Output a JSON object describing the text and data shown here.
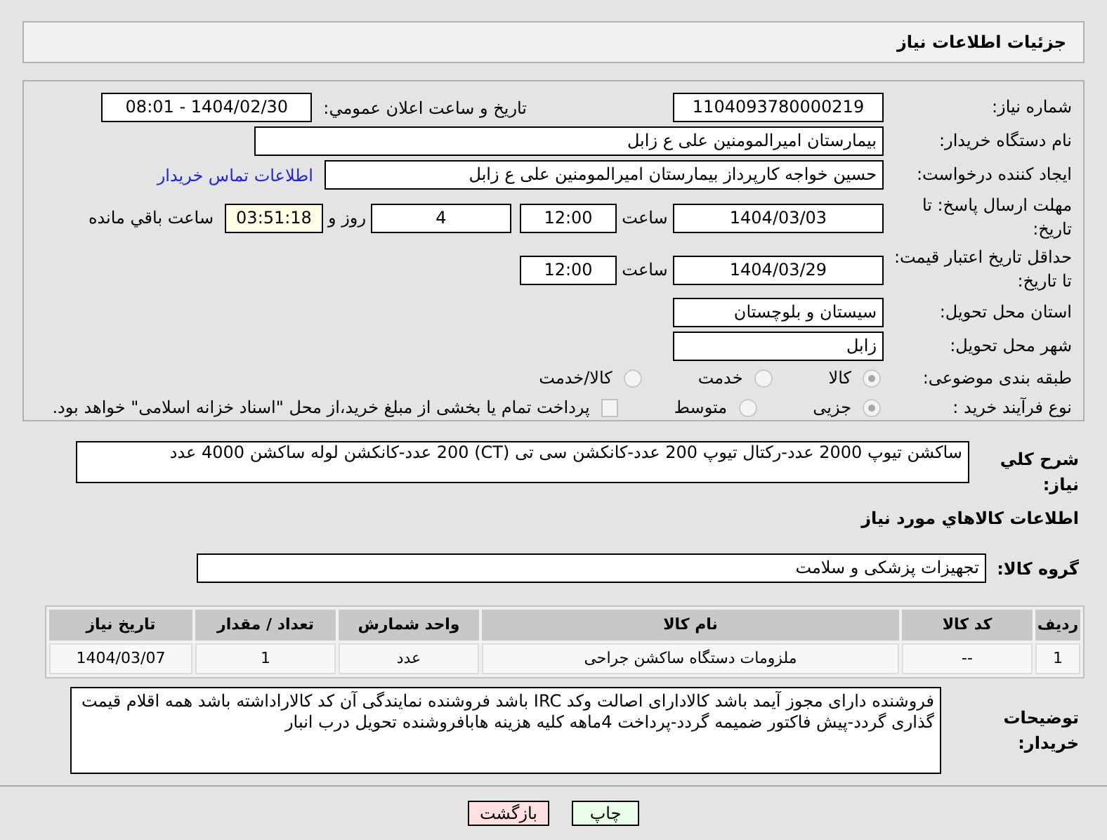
{
  "header": {
    "title": "جزئیات اطلاعات نیاز"
  },
  "form": {
    "need_number": {
      "label": "شماره نیاز:",
      "value": "1104093780000219"
    },
    "announce": {
      "label": "تاریخ و ساعت اعلان عمومي:",
      "value": "1404/02/30 - 08:01"
    },
    "buyer": {
      "label": "نام دستگاه خریدار:",
      "value": "بیمارستان امیرالمومنین علی  ع  زابل"
    },
    "creator": {
      "label": "ایجاد کننده درخواست:",
      "value": "حسین خواجه کارپرداز بیمارستان امیرالمومنین علی  ع  زابل",
      "link": "اطلاعات تماس خریدار"
    },
    "deadline": {
      "label": "مهلت ارسال پاسخ: تا تاریخ:",
      "date": "1404/03/03",
      "time_label": "ساعت",
      "time": "12:00",
      "days": "4",
      "days_label": "روز و",
      "remaining": "03:51:18",
      "remaining_label": "ساعت باقي مانده"
    },
    "validity": {
      "label": "حداقل تاریخ اعتبار قیمت: تا تاریخ:",
      "date": "1404/03/29",
      "time_label": "ساعت",
      "time": "12:00"
    },
    "province": {
      "label": "استان محل تحویل:",
      "value": "سیستان و بلوچستان"
    },
    "city": {
      "label": "شهر محل تحویل:",
      "value": "زابل"
    },
    "category": {
      "label": "طبقه بندی موضوعی:",
      "options": [
        {
          "label": "کالا",
          "selected": true
        },
        {
          "label": "خدمت",
          "selected": false
        },
        {
          "label": "کالا/خدمت",
          "selected": false
        }
      ]
    },
    "process": {
      "label": "نوع فرآیند خرید :",
      "options": [
        {
          "label": "جزیی",
          "selected": true
        },
        {
          "label": "متوسط",
          "selected": false
        }
      ],
      "treasury": {
        "label": "پرداخت تمام یا بخشی از مبلغ خرید،از محل \"اسناد خزانه اسلامی\" خواهد بود.",
        "checked": false
      }
    }
  },
  "description": {
    "label": "شرح کلي نياز:",
    "value": "ساکشن تیوپ 2000 عدد-رکتال تیوپ 200 عدد-کانکشن  سی تی (CT) 200 عدد-کانکشن لوله ساکشن 4000 عدد"
  },
  "goods_heading": "اطلاعات كالاهاي مورد نياز",
  "goods_group": {
    "label": "گروه کالا:",
    "value": "تجهیزات پزشکی و سلامت"
  },
  "table": {
    "columns": [
      "ردیف",
      "کد کالا",
      "نام کالا",
      "واحد شمارش",
      "تعداد / مقدار",
      "تاریخ نیاز"
    ],
    "rows": [
      [
        "1",
        "--",
        "ملزومات دستگاه ساکشن جراحی",
        "عدد",
        "1",
        "1404/03/07"
      ]
    ]
  },
  "buyer_notes": {
    "label": "توضیحات خریدار:",
    "value": "فروشنده دارای مجوز آیمد باشد کالادارای اصالت وکد IRC  باشد فروشنده نمایندگی آن کد کالاراداشته باشد همه اقلام قیمت گذاری گردد-پیش فاکتور ضمیمه گردد-پرداخت 4ماهه کلیه هزینه هابافروشنده تحویل درب انبار"
  },
  "buttons": [
    {
      "label": "چاپ",
      "kind": "print"
    },
    {
      "label": "بازگشت",
      "kind": "back"
    }
  ]
}
